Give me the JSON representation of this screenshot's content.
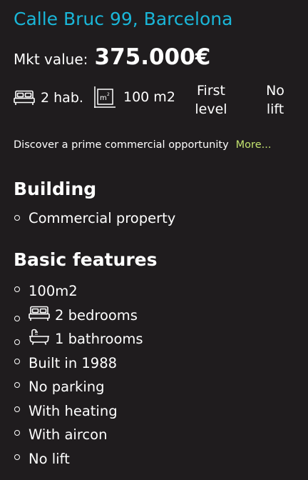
{
  "listing": {
    "title": "Calle Bruc 99, Barcelona",
    "price_label": "Mkt value:",
    "price_value": "375.000€"
  },
  "specs": {
    "beds": "2 hab.",
    "area": "100 m2",
    "level_line1": "First",
    "level_line2": "level",
    "lift_line1": "No",
    "lift_line2": "lift",
    "icons": [
      "bed-icon",
      "area-m2-icon"
    ]
  },
  "description": {
    "text": "Discover a prime commercial opportunity",
    "more_label": "More..."
  },
  "building": {
    "heading": "Building",
    "items": [
      "Commercial property"
    ]
  },
  "features": {
    "heading": "Basic features",
    "items": [
      {
        "label": "100m2"
      },
      {
        "label": "2 bedrooms",
        "icon": "bed-icon"
      },
      {
        "label": "1 bathrooms",
        "icon": "bathtub-icon"
      },
      {
        "label": "Built in 1988"
      },
      {
        "label": "No parking"
      },
      {
        "label": "With heating"
      },
      {
        "label": "With aircon"
      },
      {
        "label": "No lift"
      }
    ]
  },
  "colors": {
    "background": "#1f1c1e",
    "title": "#1ab6d8",
    "link": "#c3e36f",
    "text": "#ffffff"
  }
}
